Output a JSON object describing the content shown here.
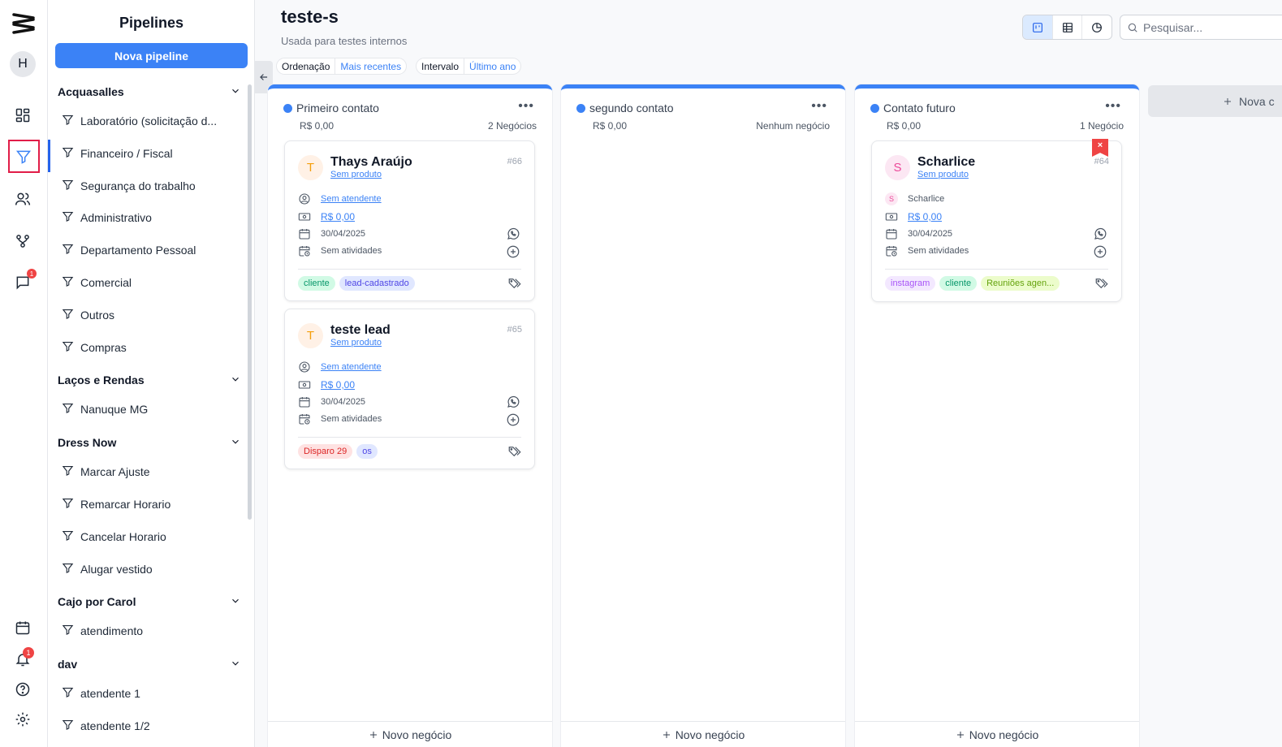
{
  "sidebar": {
    "title": "Pipelines",
    "new_button": "Nova pipeline",
    "groups": [
      {
        "name": "Acquasalles",
        "items": [
          "Laboratório (solicitação d...",
          "Financeiro / Fiscal",
          "Segurança do trabalho",
          "Administrativo",
          "Departamento Pessoal",
          "Comercial",
          "Outros",
          "Compras"
        ]
      },
      {
        "name": "Laços e Rendas",
        "items": [
          "Nanuque MG"
        ]
      },
      {
        "name": "Dress Now",
        "items": [
          "Marcar Ajuste",
          "Remarcar Horario",
          "Cancelar Horario",
          "Alugar vestido"
        ]
      },
      {
        "name": "Cajo por Carol",
        "items": [
          "atendimento"
        ]
      },
      {
        "name": "dav",
        "items": [
          "atendente 1",
          "atendente 1/2"
        ]
      }
    ]
  },
  "rail": {
    "avatar_initial": "H",
    "chat_badge": "1",
    "notification_badge": "1"
  },
  "header": {
    "title": "teste-s",
    "subtitle": "Usada para testes internos",
    "ordering_label": "Ordenação",
    "ordering_value": "Mais recentes",
    "interval_label": "Intervalo",
    "interval_value": "Último ano",
    "search_placeholder": "Pesquisar..."
  },
  "columns": [
    {
      "name": "Primeiro contato",
      "value": "R$ 0,00",
      "count": "2 Negócios",
      "footer": "Novo negócio",
      "cards": [
        {
          "initial": "T",
          "name": "Thays Araújo",
          "product": "Sem produto",
          "number": "#66",
          "attendant": "Sem atendente",
          "amount": "R$ 0,00",
          "date": "30/04/2025",
          "activities": "Sem atividades",
          "tags": [
            {
              "label": "cliente",
              "bg": "#d1fae5",
              "fg": "#059669"
            },
            {
              "label": "lead-cadastrado",
              "bg": "#e0e7ff",
              "fg": "#4f46e5"
            }
          ]
        },
        {
          "initial": "T",
          "name": "teste lead",
          "product": "Sem produto",
          "number": "#65",
          "attendant": "Sem atendente",
          "amount": "R$ 0,00",
          "date": "30/04/2025",
          "activities": "Sem atividades",
          "tags": [
            {
              "label": "Disparo 29",
              "bg": "#fee2e2",
              "fg": "#dc2626"
            },
            {
              "label": "os",
              "bg": "#e0e7ff",
              "fg": "#4f46e5"
            }
          ]
        }
      ]
    },
    {
      "name": "segundo contato",
      "value": "R$ 0,00",
      "count": "Nenhum negócio",
      "footer": "Novo negócio",
      "cards": []
    },
    {
      "name": "Contato futuro",
      "value": "R$ 0,00",
      "count": "1 Negócio",
      "footer": "Novo negócio",
      "cards": [
        {
          "initial": "S",
          "name": "Scharlice",
          "product": "Sem produto",
          "number": "#64",
          "attendant": "Scharlice",
          "amount": "R$ 0,00",
          "date": "30/04/2025",
          "activities": "Sem atividades",
          "tags": [
            {
              "label": "instagram",
              "bg": "#f3e8ff",
              "fg": "#a855f7"
            },
            {
              "label": "cliente",
              "bg": "#d1fae5",
              "fg": "#059669"
            },
            {
              "label": "Reuniões agen...",
              "bg": "#ecfccb",
              "fg": "#65a30d"
            }
          ]
        }
      ]
    }
  ],
  "new_column_label": "Nova c",
  "colors": {
    "accent": "#3b82f6",
    "danger": "#ef4444"
  }
}
